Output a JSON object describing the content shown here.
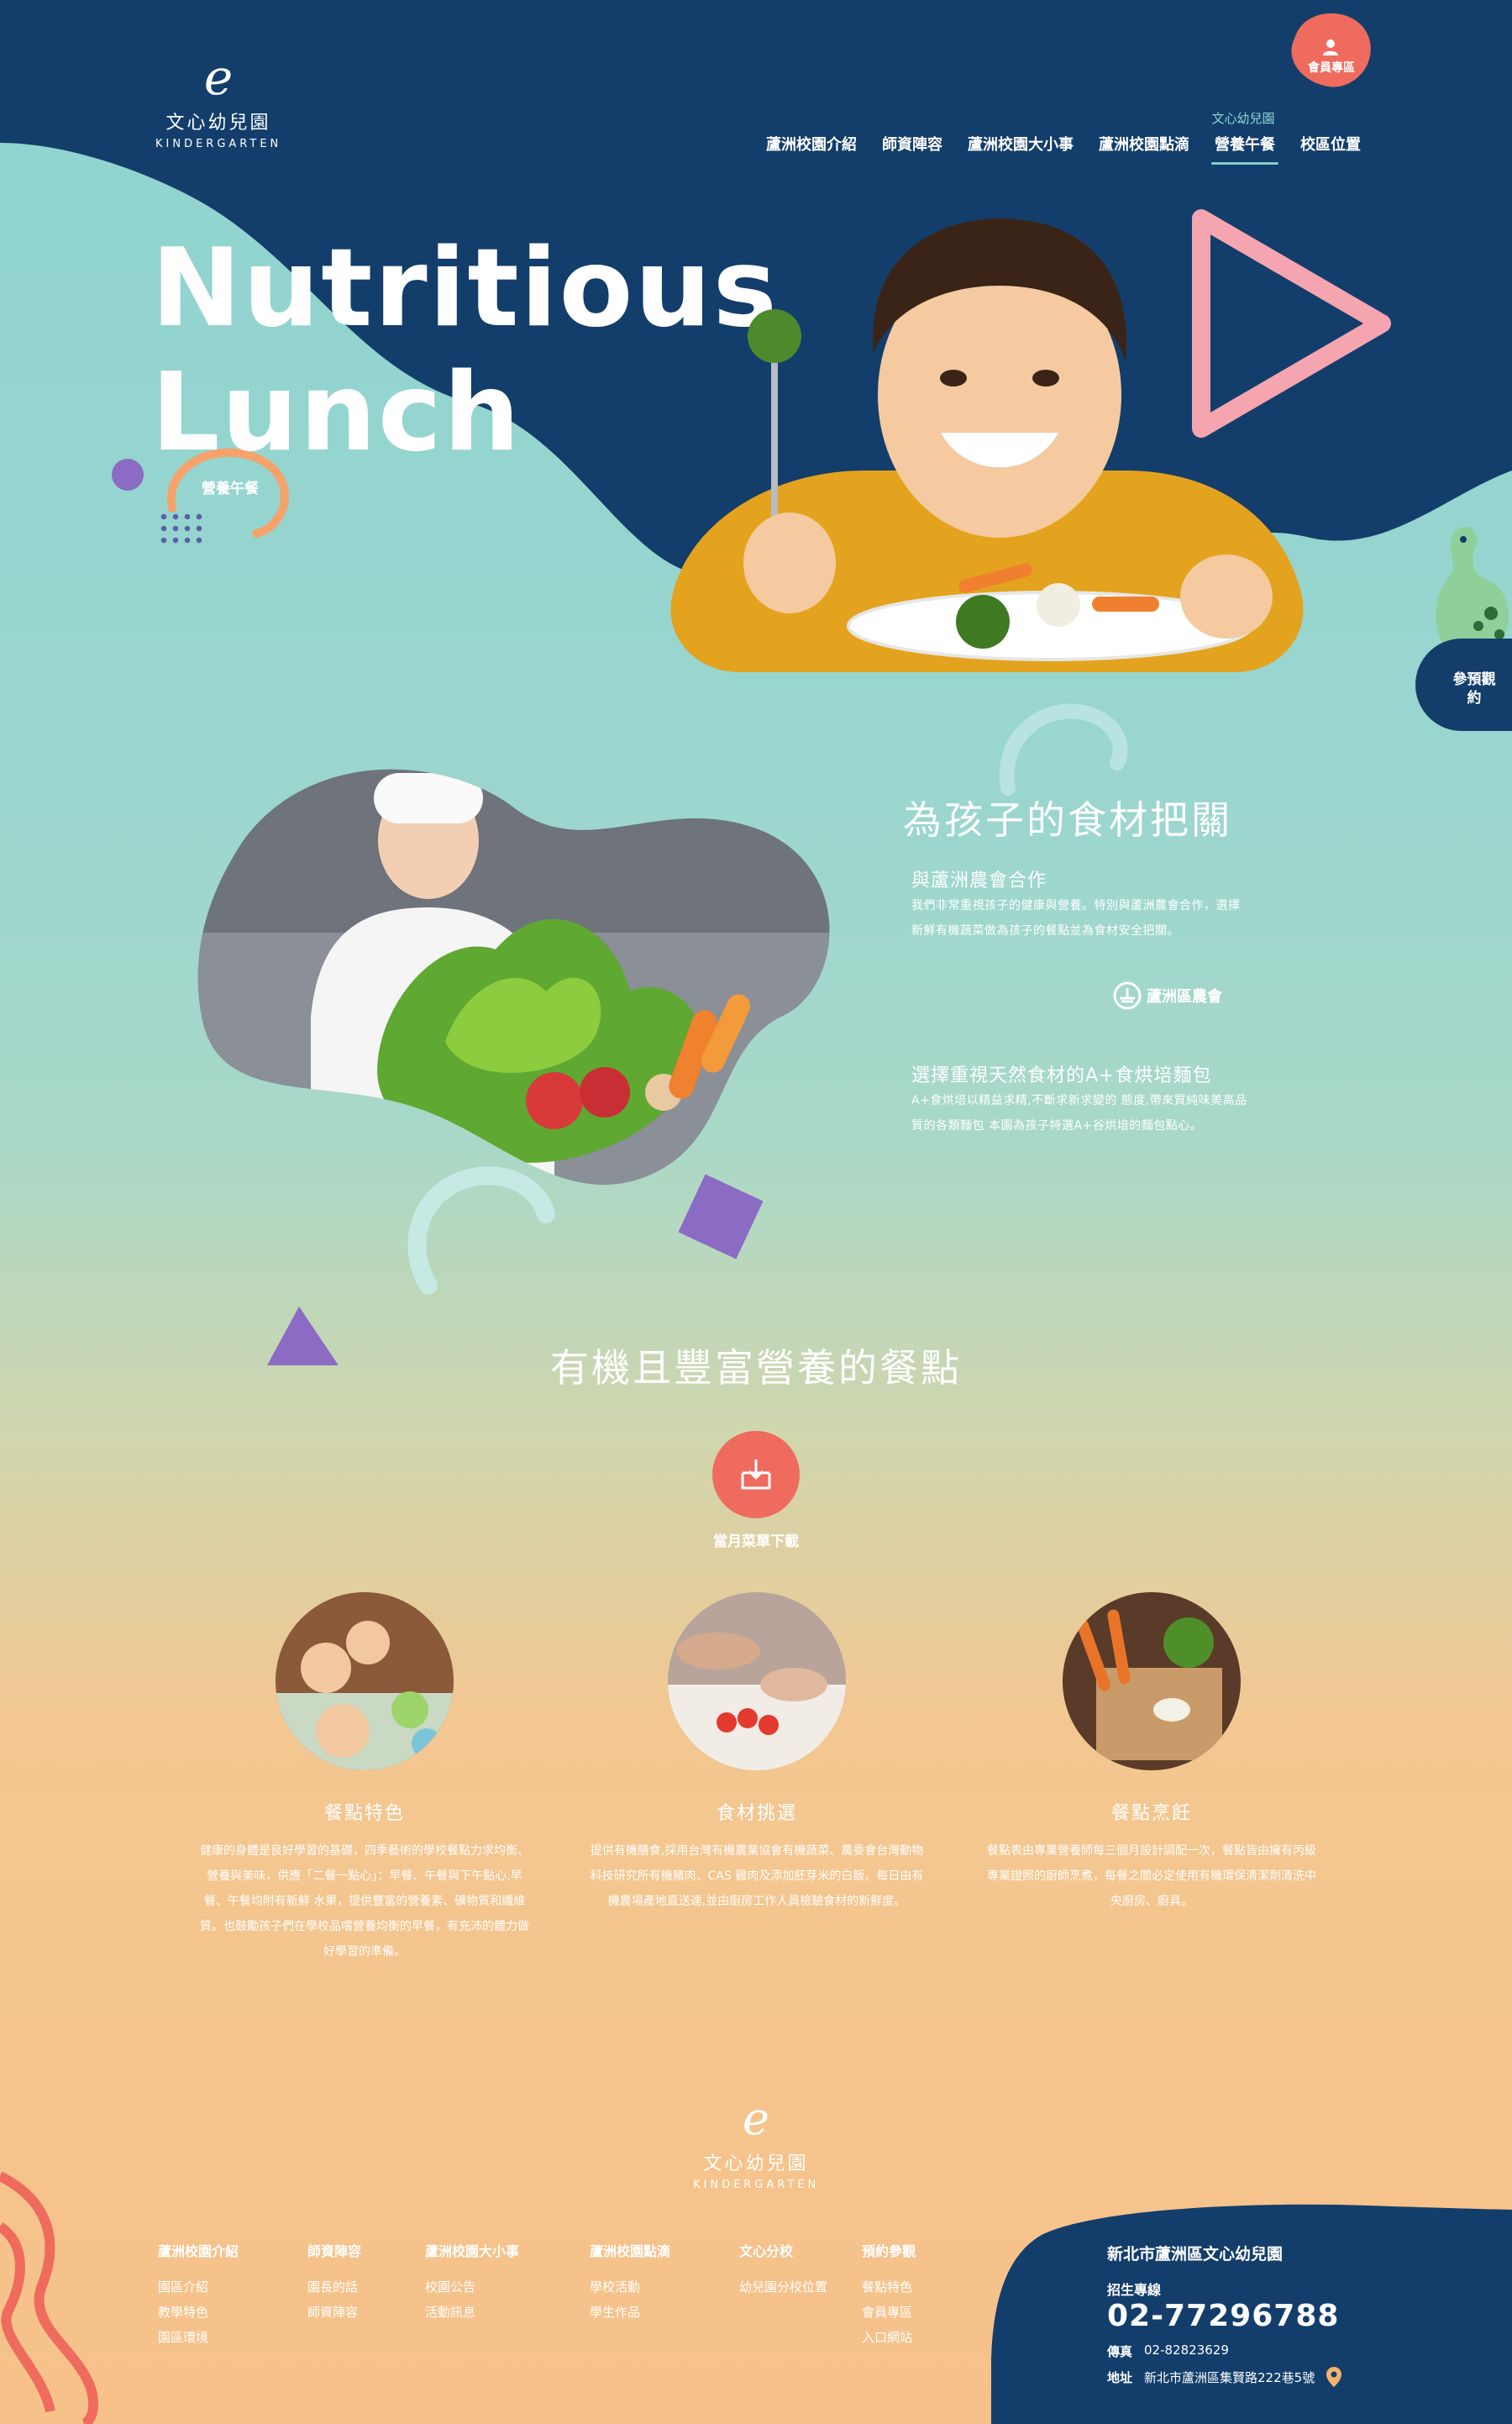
{
  "brand": {
    "name": "文心幼兒園",
    "en": "KINDERGARTEN",
    "mark": "e"
  },
  "member": {
    "label": "會員專區",
    "icon": "user-icon"
  },
  "nav": {
    "parent_label": "文心幼兒園",
    "items": [
      {
        "label": "蘆洲校園介紹"
      },
      {
        "label": "師資陣容"
      },
      {
        "label": "蘆洲校園大小事"
      },
      {
        "label": "蘆洲校園點滴"
      },
      {
        "label": "營養午餐",
        "active": true
      },
      {
        "label": "校區位置"
      }
    ]
  },
  "hero": {
    "title_line1": "Nutritious",
    "title_line2": "Lunch",
    "subtitle": "營養午餐"
  },
  "visit": {
    "label": "參預觀約"
  },
  "section1": {
    "title": "為孩子的食材把關",
    "block1": {
      "title": "與蘆洲農會合作",
      "text": "我們非常重視孩子的健康與營養。特別與蘆洲農會合作，選擇新鮮有機蔬菜做為孩子的餐點並為食材安全把關。",
      "partner": "蘆洲區農會"
    },
    "block2": {
      "title": "選擇重視天然食材的A+食烘培麵包",
      "text": "A+食烘培以精益求精,不斷求新求變的 態度,帶來質純味美高品質的各類麵包 本園為孩子特選A+谷烘培的麵包點心。"
    }
  },
  "section2": {
    "title": "有機且豐富營養的餐點",
    "download_label": "當月菜單下載",
    "features": [
      {
        "title": "餐點特色",
        "text": "健康的身體是良好學習的基礎，四季藝術的學校餐點力求均衡、營養與美味，供應「二餐一點心」：早餐、午餐與下午點心,早餐、午餐均附有新鮮 水果，提供豐富的營養素、礦物質和纖維質。也鼓勵孩子們在學校品嚐營養均衡的早餐，有充沛的體力做好學習的準備。"
      },
      {
        "title": "食材挑選",
        "text": "提供有機膳食,採用台灣有機農業協會有機蔬菜、農委會台灣動物科技研究所有機豬肉、CAS 雞肉及添加胚芽米的白飯。每日由有機農場產地直送達,並由廚房工作人員檢驗食材的新鮮度。"
      },
      {
        "title": "餐點烹飪",
        "text": "餐點表由專業營養師每三個月設計調配一次，餐點皆由擁有丙級專業證照的廚師烹煮，每餐之間必定使用有機環保清潔劑清洗中央廚房、廚具。"
      }
    ]
  },
  "footer": {
    "columns": [
      {
        "heading": "蘆洲校園介紹",
        "links": [
          "園區介紹",
          "教學特色",
          "園區環境"
        ]
      },
      {
        "heading": "師資陣容",
        "links": [
          "園長的話",
          "師資陣容"
        ]
      },
      {
        "heading": "蘆洲校園大小事",
        "links": [
          "校園公告",
          "活動訊息"
        ]
      },
      {
        "heading": "蘆洲校園點滴",
        "links": [
          "學校活動",
          "學生作品"
        ]
      },
      {
        "heading": "文心分校",
        "links": [
          "幼兒園分校位置"
        ]
      },
      {
        "heading": "預約參觀",
        "links": [
          "餐點特色",
          "會員專區",
          "入口網站"
        ]
      }
    ],
    "contact": {
      "title": "新北市蘆洲區文心幼兒園",
      "hotline_label": "招生專線",
      "hotline": "02-77296788",
      "fax_label": "傳真",
      "fax": "02-82823629",
      "address_label": "地址",
      "address": "新北市蘆洲區集賢路222巷5號"
    }
  },
  "colors": {
    "navy": "#133e6b",
    "teal": "#8fd3d0",
    "peach": "#f7c18a",
    "pink": "#f08aa0",
    "coral": "#ef6b5e",
    "purple": "#8b6bc4"
  }
}
